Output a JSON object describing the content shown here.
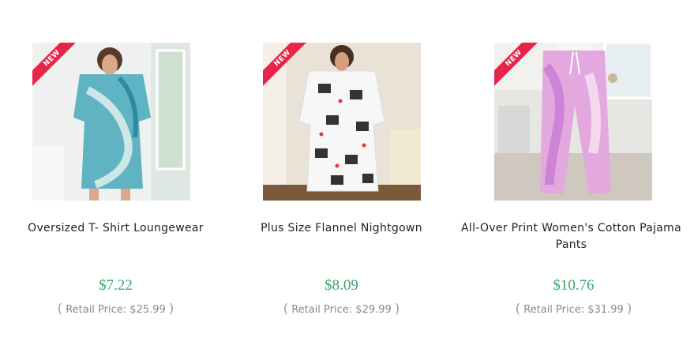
{
  "products": [
    {
      "badge": "NEW",
      "name": "Oversized T- Shirt Loungewear",
      "price": "$7.22",
      "retail_open": "(",
      "retail_label": "Retail Price:",
      "retail_price": "$25.99",
      "retail_close": ")"
    },
    {
      "badge": "NEW",
      "name": "Plus Size Flannel Nightgown",
      "price": "$8.09",
      "retail_open": "(",
      "retail_label": "Retail Price:",
      "retail_price": "$29.99",
      "retail_close": ")"
    },
    {
      "badge": "NEW",
      "name": "All-Over Print Women's Cotton Pajama Pants",
      "price": "$10.76",
      "retail_open": "(",
      "retail_label": "Retail Price:",
      "retail_price": "$31.99",
      "retail_close": ")"
    }
  ],
  "colors": {
    "price": "#3aa56c",
    "badge": "#e8244a",
    "text": "#222222",
    "muted": "#8a8a8a"
  }
}
